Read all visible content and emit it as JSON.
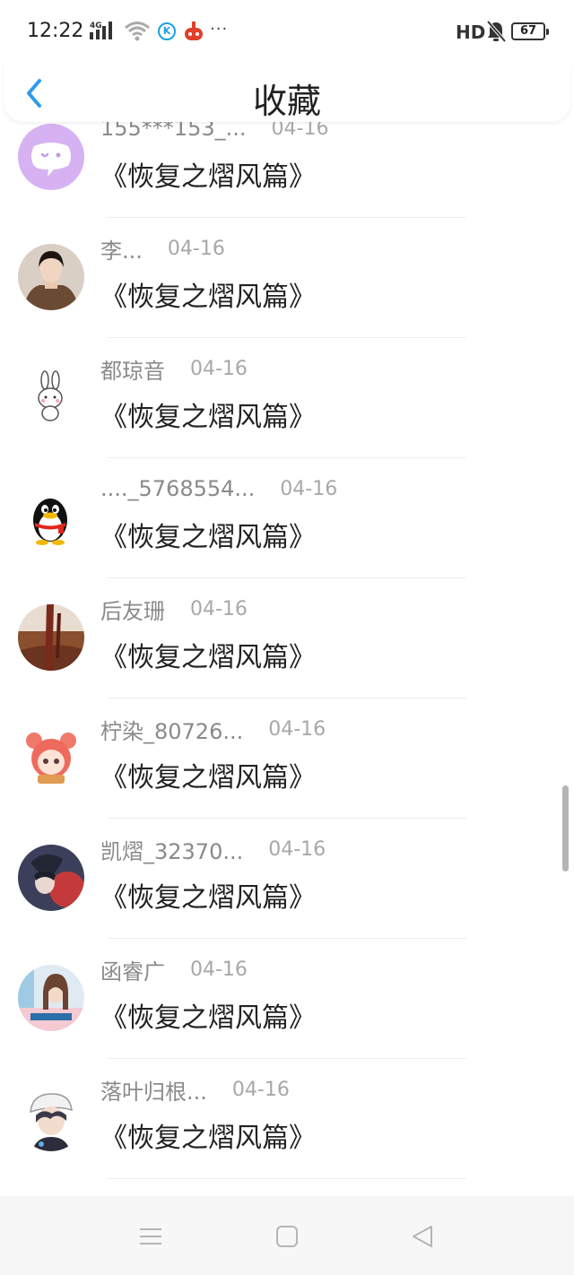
{
  "status_bar": {
    "time": "12:22",
    "network": "4G",
    "app_icon_letter": "K",
    "more": "···",
    "hd": "HD",
    "battery": "67"
  },
  "header": {
    "back_icon": "chevron-left-icon",
    "title": "收藏"
  },
  "colors": {
    "accent": "#2e9bf0",
    "title_text": "#222222",
    "meta_text": "#8a8a8a",
    "date_text": "#a8a8a8",
    "nav_bg": "#f7f7f7"
  },
  "items": [
    {
      "user": "155***153_...",
      "date": "04-16",
      "title": "《恢复之熠风篇》"
    },
    {
      "user": "李...",
      "date": "04-16",
      "title": "《恢复之熠风篇》"
    },
    {
      "user": "都琼音",
      "date": "04-16",
      "title": "《恢复之熠风篇》"
    },
    {
      "user": "...._5768554...",
      "date": "04-16",
      "title": "《恢复之熠风篇》"
    },
    {
      "user": "后友珊",
      "date": "04-16",
      "title": "《恢复之熠风篇》"
    },
    {
      "user": "柠染_80726...",
      "date": "04-16",
      "title": "《恢复之熠风篇》"
    },
    {
      "user": "凯熠_32370...",
      "date": "04-16",
      "title": "《恢复之熠风篇》"
    },
    {
      "user": "函睿广",
      "date": "04-16",
      "title": "《恢复之熠风篇》"
    },
    {
      "user": "落叶归根...",
      "date": "04-16",
      "title": "《恢复之熠风篇》"
    }
  ],
  "nav": {
    "menu_icon": "menu-icon",
    "home_icon": "home-icon",
    "back_icon": "back-triangle-icon"
  }
}
